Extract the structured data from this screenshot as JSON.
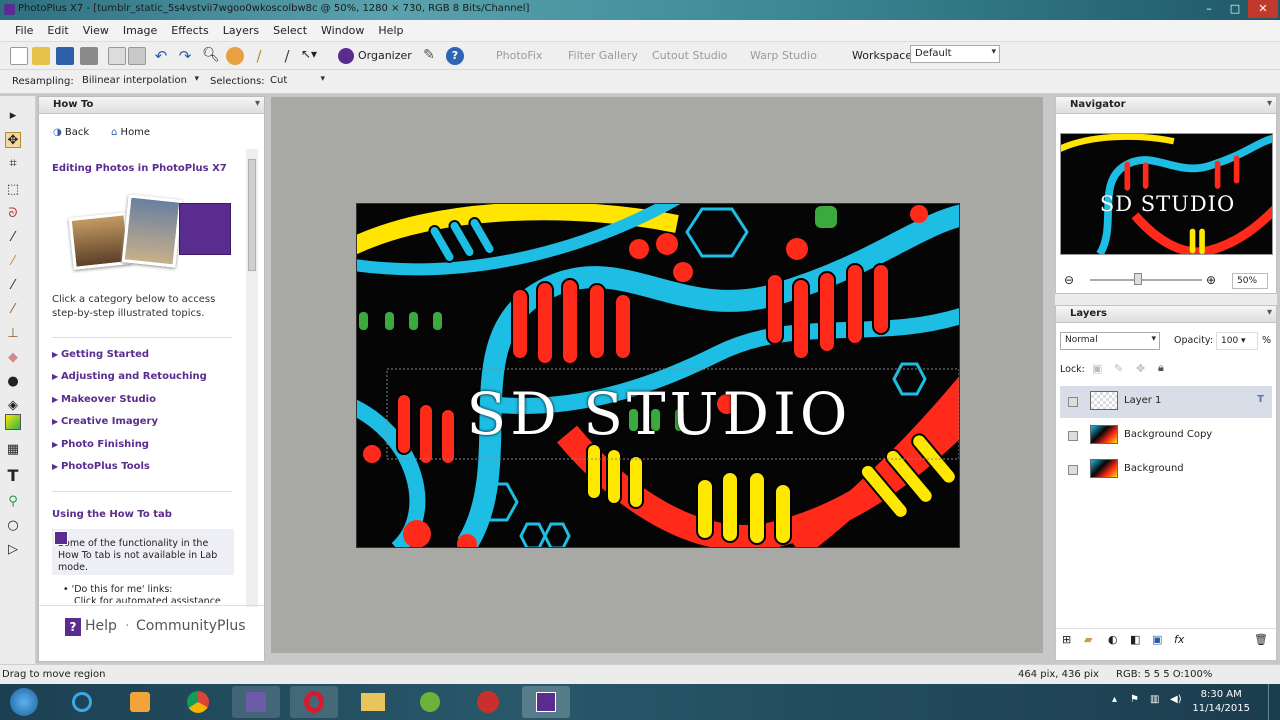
{
  "window": {
    "title": "PhotoPlus X7 - [tumblr_static_5s4vstvii7wgoo0wkoscolbw8c @ 50%, 1280 × 730, RGB 8 Bits/Channel]"
  },
  "menu": [
    "File",
    "Edit",
    "View",
    "Image",
    "Effects",
    "Layers",
    "Select",
    "Window",
    "Help"
  ],
  "toolbar": {
    "organizer": "Organizer",
    "photofix": "PhotoFix",
    "filter_gallery": "Filter Gallery",
    "cutout_studio": "Cutout Studio",
    "warp_studio": "Warp Studio",
    "workspace_label": "Workspace",
    "workspace_value": "Default"
  },
  "context_toolbar": {
    "resampling_label": "Resampling:",
    "resampling_value": "Bilinear interpolation",
    "selections_label": "Selections:",
    "selections_value": "Cut"
  },
  "howto": {
    "title": "How To",
    "back": "Back",
    "home": "Home",
    "heading": "Editing Photos in PhotoPlus X7",
    "description": "Click a category below to access step-by-step illustrated topics.",
    "categories": [
      "Getting Started",
      "Adjusting and Retouching",
      "Makeover Studio",
      "Creative Imagery",
      "Photo Finishing",
      "PhotoPlus Tools"
    ],
    "using_heading": "Using the How To tab",
    "note": "Some of the functionality in the How To tab is not available in Lab mode.",
    "bullet": "'Do this for me' links:",
    "bullet2": "Click for automated assistance",
    "help": "Help",
    "community": "CommunityPlus"
  },
  "canvas": {
    "text": "SD STUDIO"
  },
  "navigator": {
    "title": "Navigator",
    "zoom": "50%",
    "zoom_level": 0.5
  },
  "layers": {
    "title": "Layers",
    "blend": "Normal",
    "opacity_label": "Opacity:",
    "opacity_value": "100",
    "opacity_unit": "%",
    "lock_label": "Lock:",
    "items": [
      {
        "name": "Layer 1",
        "selected": true
      },
      {
        "name": "Background Copy",
        "selected": false
      },
      {
        "name": "Background",
        "selected": false
      }
    ]
  },
  "status": {
    "hint": "Drag to move region",
    "position": "464 pix, 436 pix",
    "color": "RGB: 5 5 5 O:100%"
  },
  "clock": {
    "time": "8:30 AM",
    "date": "11/14/2015"
  },
  "colors": {
    "accent": "#5b2c8f",
    "canvas_bg": "#a8a8a5"
  }
}
